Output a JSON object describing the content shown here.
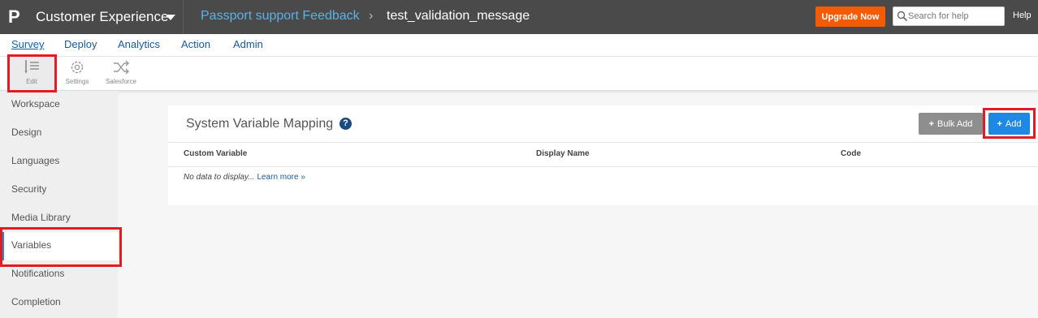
{
  "header": {
    "logo_glyph": "P",
    "app_title": "Customer Experience",
    "breadcrumb": {
      "parent": "Passport support Feedback",
      "separator": "›",
      "current": "test_validation_message"
    },
    "upgrade_label": "Upgrade Now",
    "search_placeholder": "Search for help",
    "help_label": "Help",
    "accent_color": "#f35b07"
  },
  "main_nav": {
    "items": [
      {
        "label": "Survey",
        "active": true
      },
      {
        "label": "Deploy"
      },
      {
        "label": "Analytics"
      },
      {
        "label": "Action"
      },
      {
        "label": "Admin"
      }
    ]
  },
  "toolbar": {
    "items": [
      {
        "label": "Edit",
        "icon": "edit-icon",
        "active": true
      },
      {
        "label": "Settings",
        "icon": "gear-icon"
      },
      {
        "label": "Salesforce",
        "icon": "shuffle-icon"
      }
    ]
  },
  "sidebar": {
    "items": [
      {
        "label": "Workspace"
      },
      {
        "label": "Design"
      },
      {
        "label": "Languages"
      },
      {
        "label": "Security"
      },
      {
        "label": "Media Library"
      },
      {
        "label": "Variables",
        "active": true
      },
      {
        "label": "Notifications"
      },
      {
        "label": "Completion"
      }
    ]
  },
  "panel": {
    "title": "System Variable Mapping",
    "help_glyph": "?",
    "bulk_add_label": "Bulk Add",
    "add_label": "Add",
    "plus_glyph": "+",
    "columns": [
      "Custom Variable",
      "Display Name",
      "Code"
    ],
    "empty_message": "No data to display...",
    "learn_more": "Learn more »"
  }
}
